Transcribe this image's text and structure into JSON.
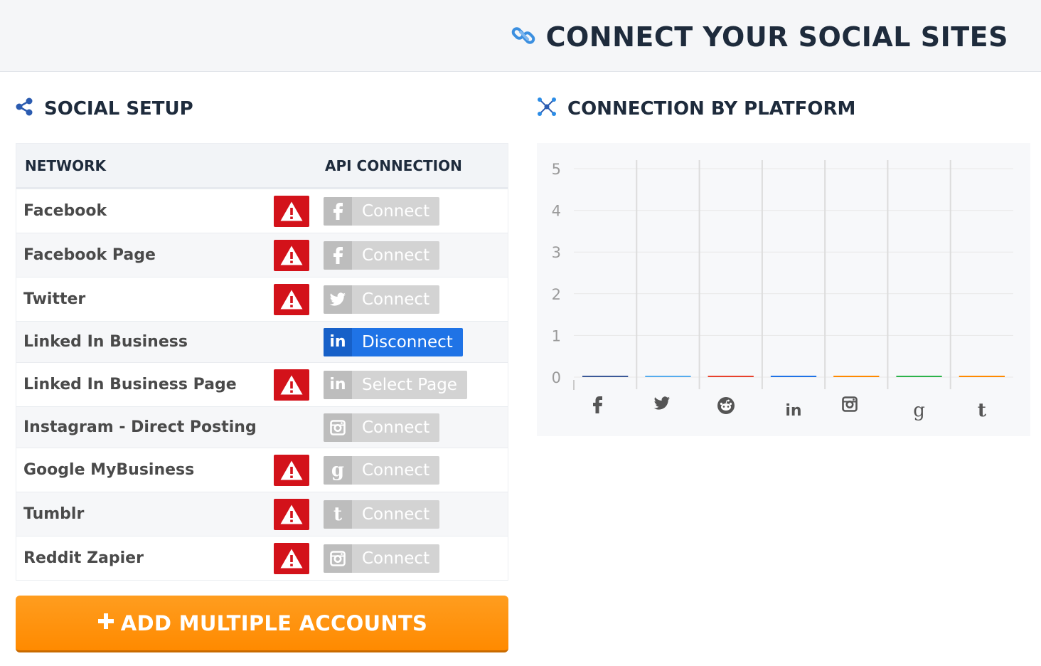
{
  "header": {
    "title": "CONNECT YOUR SOCIAL SITES",
    "icon": "link-icon"
  },
  "social_setup": {
    "title": "SOCIAL SETUP",
    "icon": "share-icon",
    "columns": {
      "network": "NETWORK",
      "api": "API CONNECTION"
    },
    "rows": [
      {
        "name": "Facebook",
        "warning": true,
        "button": "Connect",
        "icon": "f",
        "active": false
      },
      {
        "name": "Facebook Page",
        "warning": true,
        "button": "Connect",
        "icon": "f",
        "active": false
      },
      {
        "name": "Twitter",
        "warning": true,
        "button": "Connect",
        "icon": "twitter",
        "active": false
      },
      {
        "name": "Linked In Business",
        "warning": false,
        "button": "Disconnect",
        "icon": "in",
        "active": true
      },
      {
        "name": "Linked In Business Page",
        "warning": true,
        "button": "Select Page",
        "icon": "in",
        "active": false
      },
      {
        "name": "Instagram - Direct Posting",
        "warning": false,
        "button": "Connect",
        "icon": "instagram",
        "active": false
      },
      {
        "name": "Google MyBusiness",
        "warning": true,
        "button": "Connect",
        "icon": "g",
        "active": false
      },
      {
        "name": "Tumblr",
        "warning": true,
        "button": "Connect",
        "icon": "t",
        "active": false
      },
      {
        "name": "Reddit Zapier",
        "warning": true,
        "button": "Connect",
        "icon": "instagram",
        "active": false
      }
    ],
    "add_button": "ADD MULTIPLE ACCOUNTS"
  },
  "connection_chart": {
    "title": "CONNECTION BY PLATFORM",
    "icon": "network-icon"
  },
  "chart_data": {
    "type": "bar",
    "categories": [
      "facebook",
      "twitter",
      "reddit",
      "linkedin",
      "instagram",
      "google",
      "tumblr"
    ],
    "category_icons": [
      "f",
      "twitter",
      "reddit",
      "in",
      "instagram",
      "g",
      "t"
    ],
    "values": [
      0,
      0,
      0,
      0,
      0,
      0,
      0
    ],
    "colors": [
      "#3b5998",
      "#55acee",
      "#e8412c",
      "#1f73e6",
      "#ff8a00",
      "#2cb34a",
      "#ff8a00"
    ],
    "ylim": [
      0,
      5
    ],
    "yticks": [
      0,
      1,
      2,
      3,
      4,
      5
    ],
    "grid": true,
    "title": "",
    "xlabel": "",
    "ylabel": ""
  }
}
